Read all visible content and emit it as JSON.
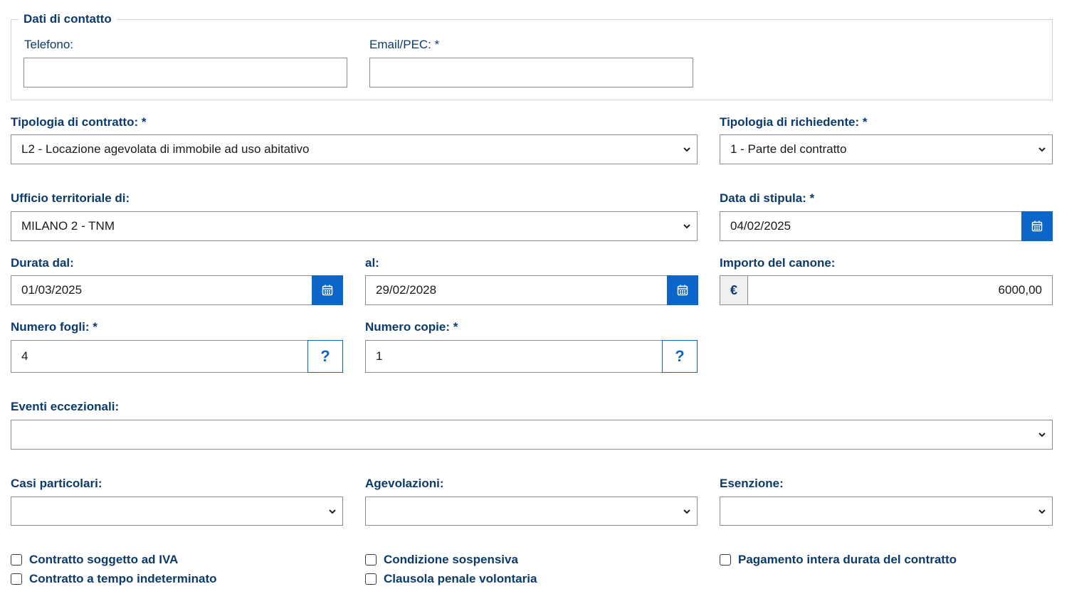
{
  "contatti": {
    "legend": "Dati di contatto",
    "telefono_label": "Telefono:",
    "telefono_value": "",
    "email_label": "Email/PEC: *",
    "email_value": ""
  },
  "tipologia_contratto": {
    "label": "Tipologia di contratto: *",
    "selected": "L2 - Locazione agevolata di immobile ad uso abitativo"
  },
  "tipologia_richiedente": {
    "label": "Tipologia di richiedente: *",
    "selected": "1 - Parte del contratto"
  },
  "ufficio": {
    "label": "Ufficio territoriale di:",
    "selected": "MILANO 2 - TNM"
  },
  "data_stipula": {
    "label": "Data di stipula: *",
    "value": "04/02/2025"
  },
  "durata": {
    "dal_label": "Durata dal:",
    "dal_value": "01/03/2025",
    "al_label": "al:",
    "al_value": "29/02/2028"
  },
  "canone": {
    "label": "Importo del canone:",
    "currency": "€",
    "value": "6000,00"
  },
  "numero_fogli": {
    "label": "Numero fogli: *",
    "value": "4",
    "help": "?"
  },
  "numero_copie": {
    "label": "Numero copie: *",
    "value": "1",
    "help": "?"
  },
  "eventi": {
    "label": "Eventi eccezionali:",
    "selected": ""
  },
  "casi": {
    "label": "Casi particolari:",
    "selected": ""
  },
  "agevolazioni": {
    "label": "Agevolazioni:",
    "selected": ""
  },
  "esenzione": {
    "label": "Esenzione:",
    "selected": ""
  },
  "checkboxes": {
    "iva": "Contratto soggetto ad IVA",
    "indeterminato": "Contratto a tempo indeterminato",
    "sospensiva": "Condizione sospensiva",
    "penale": "Clausola penale volontaria",
    "pagamento": "Pagamento intera durata del contratto"
  },
  "colors": {
    "label": "#0b3a6b",
    "accent": "#0c66c9",
    "border": "#8c8c8c"
  }
}
